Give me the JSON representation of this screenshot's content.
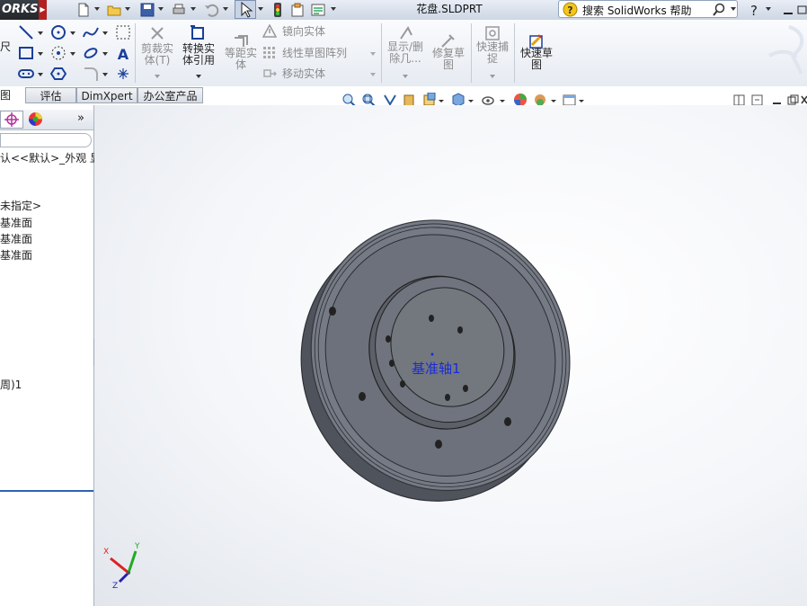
{
  "app": {
    "logo_text": "ORKS",
    "document_title": "花盘.SLDPRT"
  },
  "help": {
    "search_label": "搜索 SolidWorks 帮助"
  },
  "ribbon": {
    "partial_label": "尺",
    "trim_entities": [
      "剪裁实",
      "体(T)"
    ],
    "convert_entities": [
      "转换实",
      "体引用"
    ],
    "offset_entities": [
      "等距实",
      "体"
    ],
    "mirror_entities": "镜向实体",
    "linear_pattern": "线性草图阵列",
    "move_entities": "移动实体",
    "display_delete": [
      "显示/删",
      "除几..."
    ],
    "repair_sketch": [
      "修复草",
      "图"
    ],
    "quick_snaps": [
      "快速捕",
      "捉"
    ],
    "rapid_sketch": [
      "快速草",
      "图"
    ]
  },
  "tabs": [
    "图",
    "评估",
    "DimXpert",
    "办公室产品"
  ],
  "tree": {
    "display_state": "认<<默认>_外观 显示",
    "items": [
      "未指定>",
      "基准面",
      "基准面",
      "基准面",
      "周)1"
    ]
  },
  "model": {
    "axis_label": "基准轴1"
  },
  "triad": {
    "x": "X",
    "y": "Y",
    "z": "Z"
  }
}
